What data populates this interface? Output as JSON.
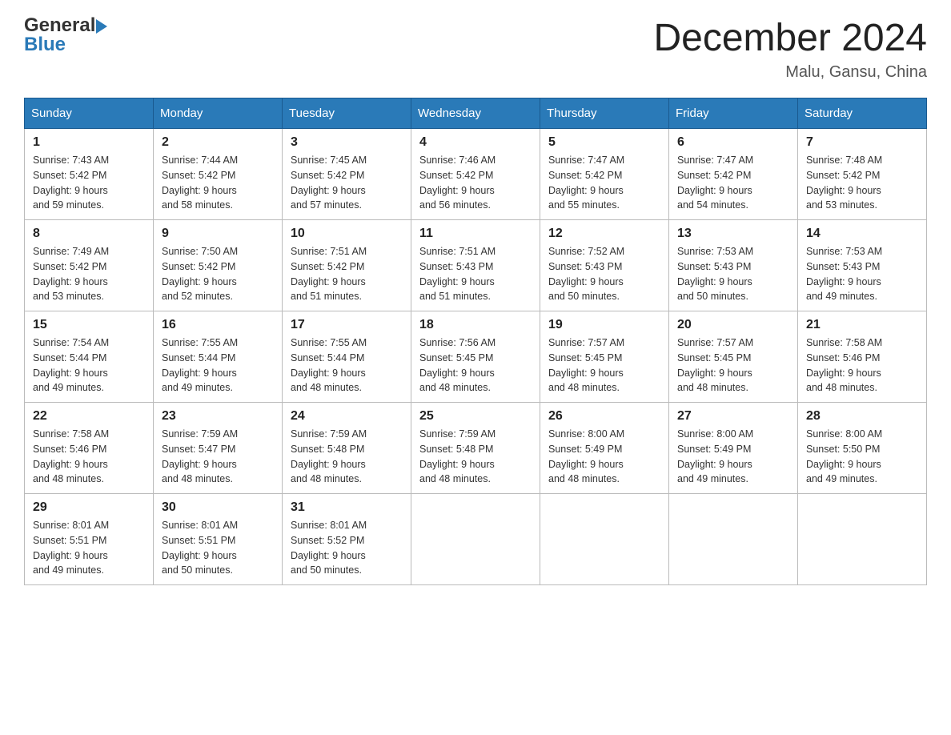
{
  "header": {
    "month_title": "December 2024",
    "location": "Malu, Gansu, China",
    "logo_general": "General",
    "logo_blue": "Blue"
  },
  "days_of_week": [
    "Sunday",
    "Monday",
    "Tuesday",
    "Wednesday",
    "Thursday",
    "Friday",
    "Saturday"
  ],
  "weeks": [
    [
      {
        "day": "1",
        "sunrise": "Sunrise: 7:43 AM",
        "sunset": "Sunset: 5:42 PM",
        "daylight": "Daylight: 9 hours",
        "minutes": "and 59 minutes."
      },
      {
        "day": "2",
        "sunrise": "Sunrise: 7:44 AM",
        "sunset": "Sunset: 5:42 PM",
        "daylight": "Daylight: 9 hours",
        "minutes": "and 58 minutes."
      },
      {
        "day": "3",
        "sunrise": "Sunrise: 7:45 AM",
        "sunset": "Sunset: 5:42 PM",
        "daylight": "Daylight: 9 hours",
        "minutes": "and 57 minutes."
      },
      {
        "day": "4",
        "sunrise": "Sunrise: 7:46 AM",
        "sunset": "Sunset: 5:42 PM",
        "daylight": "Daylight: 9 hours",
        "minutes": "and 56 minutes."
      },
      {
        "day": "5",
        "sunrise": "Sunrise: 7:47 AM",
        "sunset": "Sunset: 5:42 PM",
        "daylight": "Daylight: 9 hours",
        "minutes": "and 55 minutes."
      },
      {
        "day": "6",
        "sunrise": "Sunrise: 7:47 AM",
        "sunset": "Sunset: 5:42 PM",
        "daylight": "Daylight: 9 hours",
        "minutes": "and 54 minutes."
      },
      {
        "day": "7",
        "sunrise": "Sunrise: 7:48 AM",
        "sunset": "Sunset: 5:42 PM",
        "daylight": "Daylight: 9 hours",
        "minutes": "and 53 minutes."
      }
    ],
    [
      {
        "day": "8",
        "sunrise": "Sunrise: 7:49 AM",
        "sunset": "Sunset: 5:42 PM",
        "daylight": "Daylight: 9 hours",
        "minutes": "and 53 minutes."
      },
      {
        "day": "9",
        "sunrise": "Sunrise: 7:50 AM",
        "sunset": "Sunset: 5:42 PM",
        "daylight": "Daylight: 9 hours",
        "minutes": "and 52 minutes."
      },
      {
        "day": "10",
        "sunrise": "Sunrise: 7:51 AM",
        "sunset": "Sunset: 5:42 PM",
        "daylight": "Daylight: 9 hours",
        "minutes": "and 51 minutes."
      },
      {
        "day": "11",
        "sunrise": "Sunrise: 7:51 AM",
        "sunset": "Sunset: 5:43 PM",
        "daylight": "Daylight: 9 hours",
        "minutes": "and 51 minutes."
      },
      {
        "day": "12",
        "sunrise": "Sunrise: 7:52 AM",
        "sunset": "Sunset: 5:43 PM",
        "daylight": "Daylight: 9 hours",
        "minutes": "and 50 minutes."
      },
      {
        "day": "13",
        "sunrise": "Sunrise: 7:53 AM",
        "sunset": "Sunset: 5:43 PM",
        "daylight": "Daylight: 9 hours",
        "minutes": "and 50 minutes."
      },
      {
        "day": "14",
        "sunrise": "Sunrise: 7:53 AM",
        "sunset": "Sunset: 5:43 PM",
        "daylight": "Daylight: 9 hours",
        "minutes": "and 49 minutes."
      }
    ],
    [
      {
        "day": "15",
        "sunrise": "Sunrise: 7:54 AM",
        "sunset": "Sunset: 5:44 PM",
        "daylight": "Daylight: 9 hours",
        "minutes": "and 49 minutes."
      },
      {
        "day": "16",
        "sunrise": "Sunrise: 7:55 AM",
        "sunset": "Sunset: 5:44 PM",
        "daylight": "Daylight: 9 hours",
        "minutes": "and 49 minutes."
      },
      {
        "day": "17",
        "sunrise": "Sunrise: 7:55 AM",
        "sunset": "Sunset: 5:44 PM",
        "daylight": "Daylight: 9 hours",
        "minutes": "and 48 minutes."
      },
      {
        "day": "18",
        "sunrise": "Sunrise: 7:56 AM",
        "sunset": "Sunset: 5:45 PM",
        "daylight": "Daylight: 9 hours",
        "minutes": "and 48 minutes."
      },
      {
        "day": "19",
        "sunrise": "Sunrise: 7:57 AM",
        "sunset": "Sunset: 5:45 PM",
        "daylight": "Daylight: 9 hours",
        "minutes": "and 48 minutes."
      },
      {
        "day": "20",
        "sunrise": "Sunrise: 7:57 AM",
        "sunset": "Sunset: 5:45 PM",
        "daylight": "Daylight: 9 hours",
        "minutes": "and 48 minutes."
      },
      {
        "day": "21",
        "sunrise": "Sunrise: 7:58 AM",
        "sunset": "Sunset: 5:46 PM",
        "daylight": "Daylight: 9 hours",
        "minutes": "and 48 minutes."
      }
    ],
    [
      {
        "day": "22",
        "sunrise": "Sunrise: 7:58 AM",
        "sunset": "Sunset: 5:46 PM",
        "daylight": "Daylight: 9 hours",
        "minutes": "and 48 minutes."
      },
      {
        "day": "23",
        "sunrise": "Sunrise: 7:59 AM",
        "sunset": "Sunset: 5:47 PM",
        "daylight": "Daylight: 9 hours",
        "minutes": "and 48 minutes."
      },
      {
        "day": "24",
        "sunrise": "Sunrise: 7:59 AM",
        "sunset": "Sunset: 5:48 PM",
        "daylight": "Daylight: 9 hours",
        "minutes": "and 48 minutes."
      },
      {
        "day": "25",
        "sunrise": "Sunrise: 7:59 AM",
        "sunset": "Sunset: 5:48 PM",
        "daylight": "Daylight: 9 hours",
        "minutes": "and 48 minutes."
      },
      {
        "day": "26",
        "sunrise": "Sunrise: 8:00 AM",
        "sunset": "Sunset: 5:49 PM",
        "daylight": "Daylight: 9 hours",
        "minutes": "and 48 minutes."
      },
      {
        "day": "27",
        "sunrise": "Sunrise: 8:00 AM",
        "sunset": "Sunset: 5:49 PM",
        "daylight": "Daylight: 9 hours",
        "minutes": "and 49 minutes."
      },
      {
        "day": "28",
        "sunrise": "Sunrise: 8:00 AM",
        "sunset": "Sunset: 5:50 PM",
        "daylight": "Daylight: 9 hours",
        "minutes": "and 49 minutes."
      }
    ],
    [
      {
        "day": "29",
        "sunrise": "Sunrise: 8:01 AM",
        "sunset": "Sunset: 5:51 PM",
        "daylight": "Daylight: 9 hours",
        "minutes": "and 49 minutes."
      },
      {
        "day": "30",
        "sunrise": "Sunrise: 8:01 AM",
        "sunset": "Sunset: 5:51 PM",
        "daylight": "Daylight: 9 hours",
        "minutes": "and 50 minutes."
      },
      {
        "day": "31",
        "sunrise": "Sunrise: 8:01 AM",
        "sunset": "Sunset: 5:52 PM",
        "daylight": "Daylight: 9 hours",
        "minutes": "and 50 minutes."
      },
      null,
      null,
      null,
      null
    ]
  ]
}
